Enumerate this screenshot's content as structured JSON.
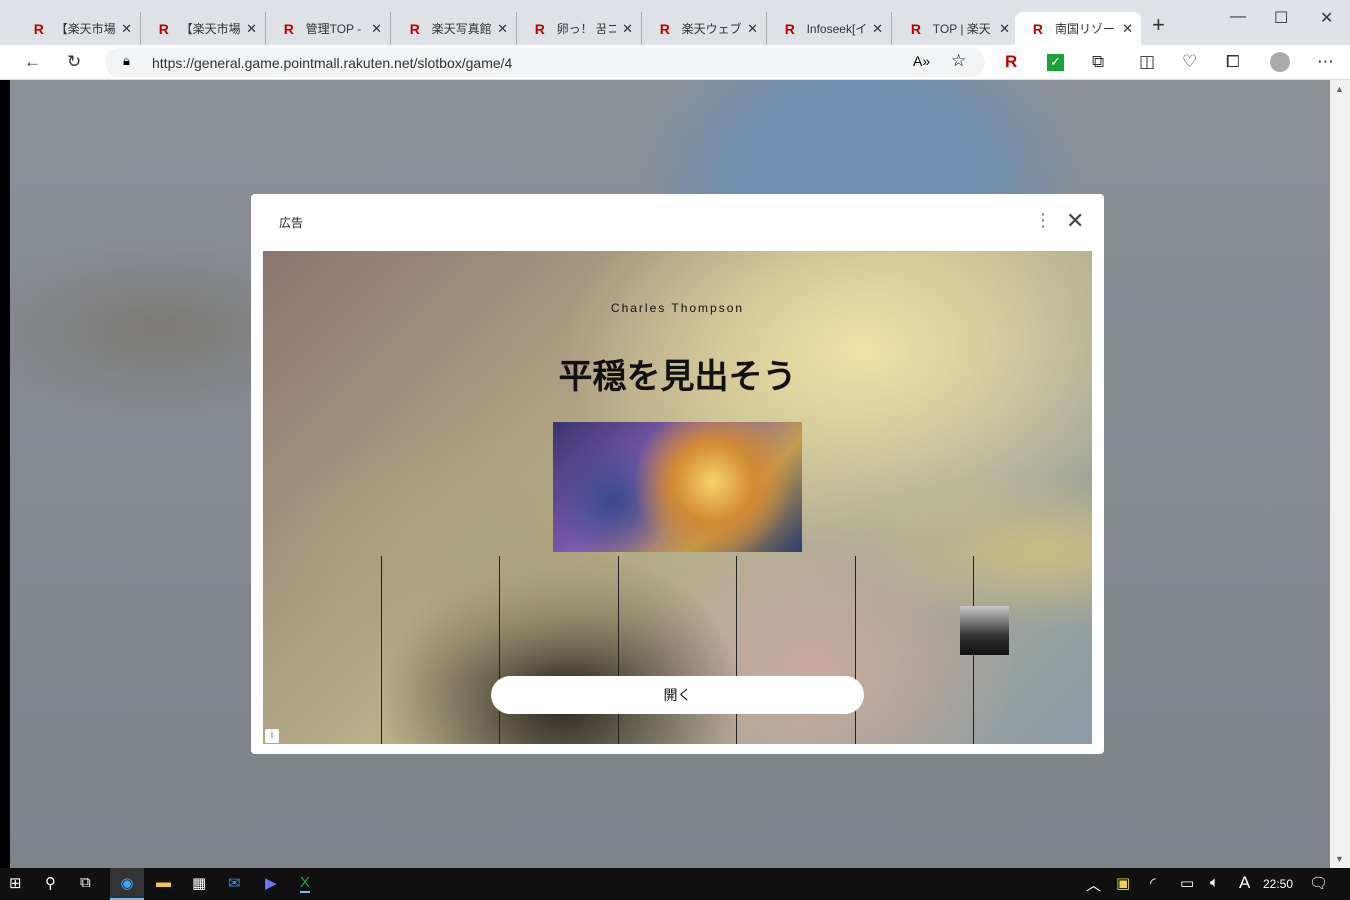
{
  "browser": {
    "tabs": [
      {
        "label": "【楽天市場】"
      },
      {
        "label": "【楽天市場】"
      },
      {
        "label": "管理TOP - "
      },
      {
        "label": "楽天写真館"
      },
      {
        "label": "卵っ！ 꿈コレ"
      },
      {
        "label": "楽天ウェブ検"
      },
      {
        "label": "Infoseek[イ"
      },
      {
        "label": "TOP | 楽天"
      },
      {
        "label": "南国リゾート"
      }
    ],
    "new_tab": "+",
    "url": "https://general.game.pointmall.rakuten.net/slotbox/game/4"
  },
  "ad": {
    "label": "広告",
    "author": "Charles Thompson",
    "title": "平穏を見出そう",
    "open_button": "開く",
    "info": "i"
  },
  "taskbar": {
    "time": "22:50",
    "ime": "A"
  }
}
